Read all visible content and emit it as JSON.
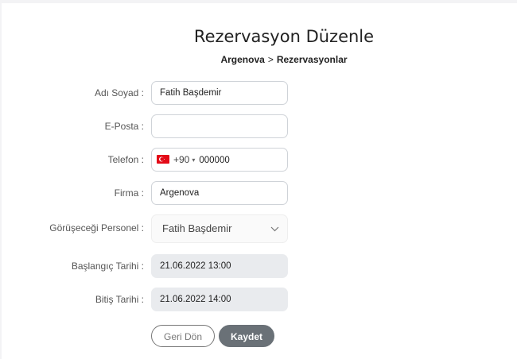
{
  "header": {
    "title": "Rezervasyon Düzenle",
    "breadcrumb": {
      "root": "Argenova",
      "separator": ">",
      "current": "Rezervasyonlar"
    }
  },
  "form": {
    "name": {
      "label": "Adı Soyad :",
      "value": "Fatih Başdemir"
    },
    "email": {
      "label": "E-Posta :",
      "value": ""
    },
    "phone": {
      "label": "Telefon :",
      "country_flag": "turkey-flag-icon",
      "dial_code": "+90",
      "caret": "▾",
      "value": "000000"
    },
    "company": {
      "label": "Firma :",
      "value": "Argenova"
    },
    "staff": {
      "label": "Görüşeceği Personel :",
      "value": "Fatih Başdemir",
      "chevron": "chevron-down-icon"
    },
    "start": {
      "label": "Başlangıç Tarihi :",
      "value": "21.06.2022 13:00"
    },
    "end": {
      "label": "Bitiş Tarihi :",
      "value": "21.06.2022 14:00"
    }
  },
  "buttons": {
    "back_label": "Geri Dön",
    "save_label": "Kaydet"
  },
  "colors": {
    "save_bg": "#6a7177",
    "readonly_bg": "#e9ebee",
    "flag_red": "#e30a17"
  }
}
